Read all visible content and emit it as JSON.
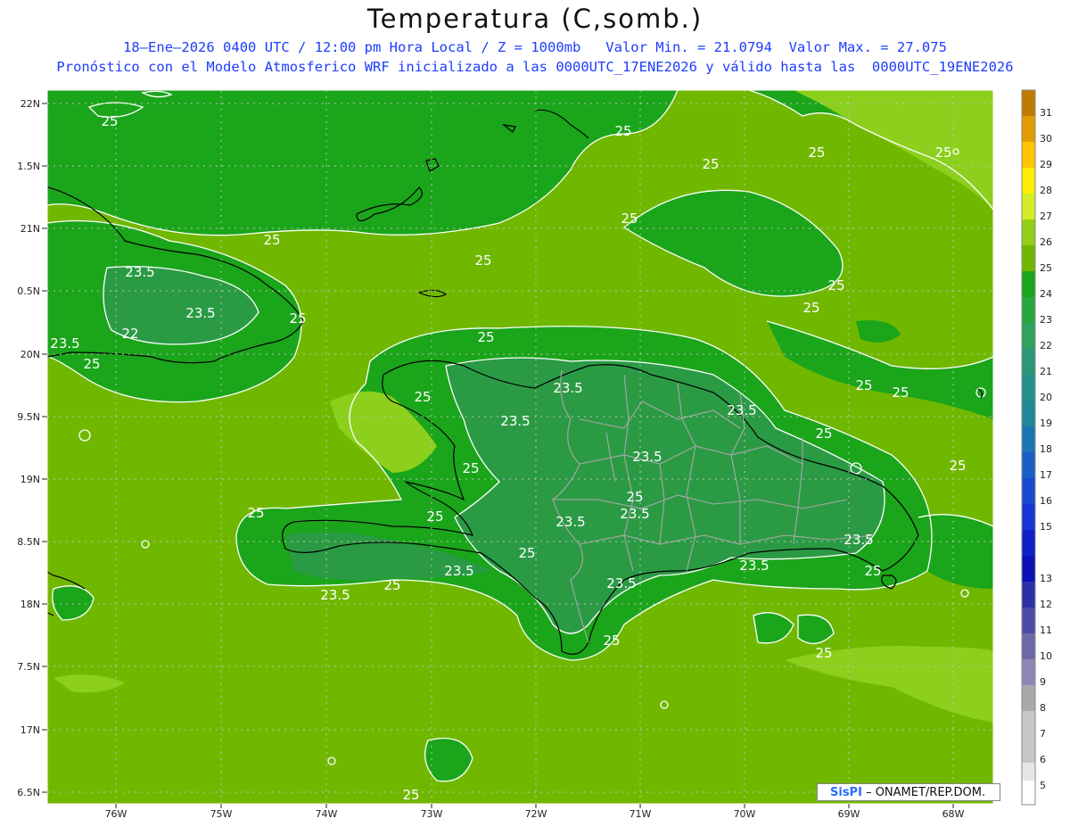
{
  "header": {
    "title": "Temperatura (C,somb.)",
    "subtitle1": "18–Ene–2026 0400 UTC / 12:00 pm Hora Local / Z = 1000mb   Valor Min. = 21.0794  Valor Max. = 27.075",
    "subtitle2": "Pronóstico con el Modelo Atmosferico WRF inicializado a las 0000UTC_17ENE2026 y válido hasta las  0000UTC_19ENE2026"
  },
  "map": {
    "lat_labels": [
      "22N",
      "1.5N",
      "21N",
      "0.5N",
      "20N",
      "9.5N",
      "19N",
      "8.5N",
      "18N",
      "7.5N",
      "17N",
      "6.5N"
    ],
    "lon_labels": [
      "76W",
      "75W",
      "74W",
      "73W",
      "72W",
      "71W",
      "70W",
      "69W",
      "68W"
    ],
    "contour_labels": [
      "25",
      "25",
      "25",
      "25",
      "25",
      "25",
      "25",
      "25",
      "25",
      "23.5",
      "23.5",
      "22",
      "23.5",
      "25",
      "25",
      "25",
      "25",
      "23.5",
      "23.5",
      "23.5",
      "25",
      "25",
      "25",
      "23.5",
      "23.5",
      "25",
      "25",
      "23.5",
      "25",
      "23.5",
      "23.5",
      "25",
      "25",
      "25",
      "25",
      "25",
      "23.5",
      "23.5",
      "25",
      "25",
      "25"
    ],
    "colors": {
      "ocean": "#70b800",
      "band25": "#1ba51b",
      "band23_5": "#2b9a45",
      "warm": "#8ccf1c",
      "coast": "#000000",
      "borders": "#a8a8a8",
      "contour": "#ffffff"
    }
  },
  "colorbar": {
    "labels": [
      "31",
      "30",
      "29",
      "28",
      "27",
      "26",
      "25",
      "24",
      "23",
      "22",
      "21",
      "20",
      "19",
      "18",
      "17",
      "16",
      "15",
      "13",
      "12",
      "11",
      "10",
      "9",
      "8",
      "7",
      "6",
      "5"
    ],
    "colors": [
      "#c07a00",
      "#e09c00",
      "#ffc400",
      "#ffee00",
      "#d4ec28",
      "#93cf14",
      "#70b800",
      "#1ba51b",
      "#29a73f",
      "#2fa25d",
      "#2c9776",
      "#249088",
      "#1f8797",
      "#1c75b2",
      "#1a5fc6",
      "#1849d0",
      "#1535d2",
      "#1020c8",
      "#0a12b5",
      "#2d2fa8",
      "#4c4ca8",
      "#6e6aa8",
      "#8f86b6",
      "#a9a9a9",
      "#c6c6c6",
      "#e6e6e6"
    ]
  },
  "credit": {
    "logo": "SisPI",
    "text": "– ONAMET/REP.DOM."
  }
}
